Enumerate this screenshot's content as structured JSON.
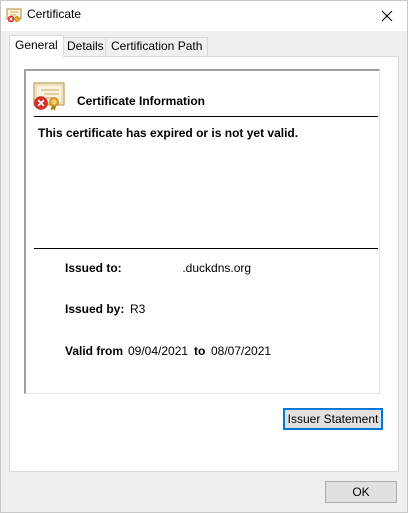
{
  "window": {
    "title": "Certificate",
    "icon": "certificate-icon",
    "close_glyph": "✕"
  },
  "tabs": [
    {
      "label": "General",
      "active": true
    },
    {
      "label": "Details",
      "active": false
    },
    {
      "label": "Certification Path",
      "active": false
    }
  ],
  "info": {
    "icon": "certificate-error-icon",
    "heading": "Certificate Information",
    "warning": "This certificate has expired or is not yet valid.",
    "issued_to_label": "Issued to:",
    "issued_to_value": " .duckdns.org",
    "issued_by_label": "Issued by:",
    "issued_by_value": "R3",
    "valid_from_label": "Valid from",
    "valid_from_value": "09/04/2021",
    "valid_to_label": "to",
    "valid_to_value": "08/07/2021"
  },
  "buttons": {
    "issuer_statement": "Issuer Statement",
    "ok": "OK"
  },
  "colors": {
    "focus_border": "#0078d7",
    "error_red": "#d9302c",
    "seal_gold": "#e2a72a"
  }
}
